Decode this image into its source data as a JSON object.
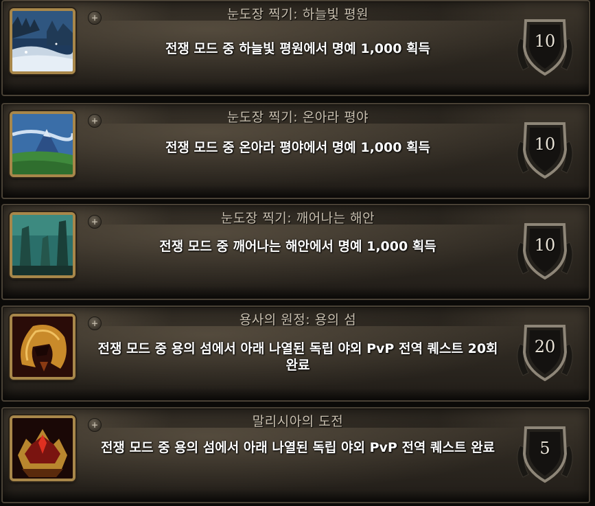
{
  "achievements": [
    {
      "title": "눈도장 찍기: 하늘빛 평원",
      "description": "전쟁 모드 중 하늘빛 평원에서 명예 1,000 획득",
      "points": "10",
      "icon": "snowy-plains-icon"
    },
    {
      "title": "눈도장 찍기: 온아라 평야",
      "description": "전쟁 모드 중 온아라 평야에서 명예 1,000 획득",
      "points": "10",
      "icon": "mountain-plains-icon"
    },
    {
      "title": "눈도장 찍기: 깨어나는 해안",
      "description": "전쟁 모드 중 깨어나는 해안에서 명예 1,000 획득",
      "points": "10",
      "icon": "coast-rocks-icon"
    },
    {
      "title": "용사의 원정: 용의 섬",
      "description": "전쟁 모드 중 용의 섬에서 아래 나열된 독립 야외 PvP 전역 퀘스트 20회 완료",
      "points": "20",
      "icon": "dragon-helm-icon"
    },
    {
      "title": "말리시아의 도전",
      "description": "전쟁 모드 중 용의 섬에서 아래 나열된 독립 야외 PvP 전역 퀘스트 완료",
      "points": "5",
      "icon": "crimson-helm-icon"
    }
  ],
  "expand_symbol": "+"
}
